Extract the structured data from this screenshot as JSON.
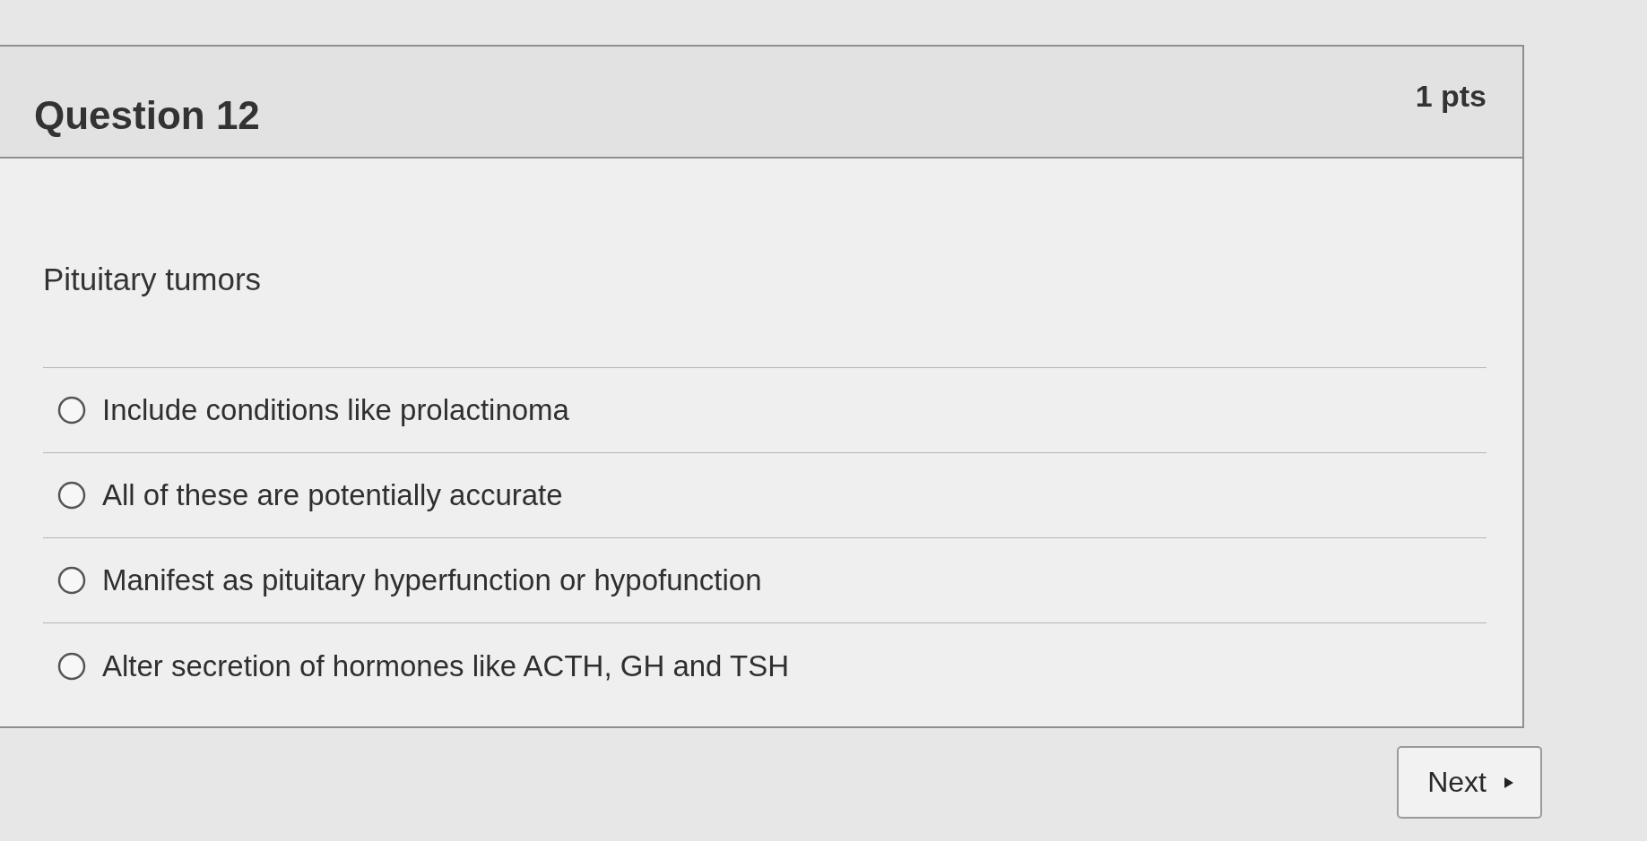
{
  "question": {
    "title": "Question 12",
    "points": "1 pts",
    "prompt": "Pituitary tumors",
    "answers": [
      {
        "text": "Include conditions like prolactinoma",
        "selected": false
      },
      {
        "text": "All of these are potentially accurate",
        "selected": false
      },
      {
        "text": "Manifest as pituitary hyperfunction or hypofunction",
        "selected": false
      },
      {
        "text": "Alter secretion of hormones like ACTH, GH and TSH",
        "selected": false
      }
    ]
  },
  "navigation": {
    "next_label": "Next"
  }
}
